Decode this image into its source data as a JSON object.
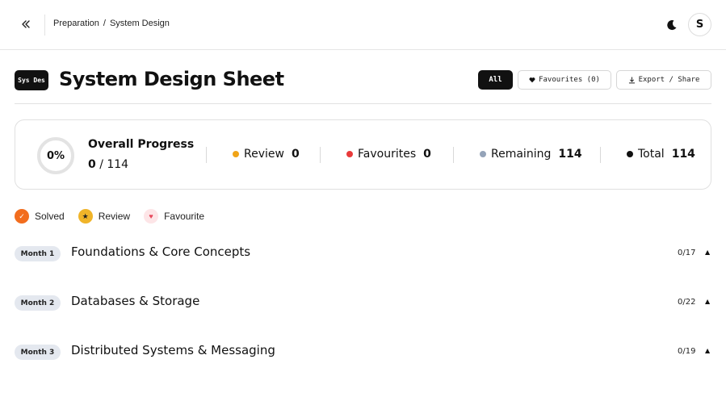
{
  "breadcrumb": {
    "parent": "Preparation",
    "separator": "/",
    "current": "System Design"
  },
  "user": {
    "initial": "S"
  },
  "sheet": {
    "badge": "Sys Des",
    "title": "System Design Sheet"
  },
  "filters": {
    "all": "All",
    "favourites": "Favourites (0)",
    "export": "Export / Share"
  },
  "progress": {
    "percent_label": "0%",
    "percent_value": 0,
    "label": "Overall Progress",
    "solved": "0",
    "total_suffix": "/ 114",
    "stats": [
      {
        "label": "Review",
        "value": "0",
        "color": "#f0a418"
      },
      {
        "label": "Favourites",
        "value": "0",
        "color": "#e83a3a"
      },
      {
        "label": "Remaining",
        "value": "114",
        "color": "#94a3b8"
      },
      {
        "label": "Total",
        "value": "114",
        "color": "#111111"
      }
    ]
  },
  "legend": [
    {
      "label": "Solved",
      "icon": "check-icon"
    },
    {
      "label": "Review",
      "icon": "star-icon"
    },
    {
      "label": "Favourite",
      "icon": "heart-icon"
    }
  ],
  "months": [
    {
      "badge": "Month 1",
      "title": "Foundations & Core Concepts",
      "count": "0/17"
    },
    {
      "badge": "Month 2",
      "title": "Databases & Storage",
      "count": "0/22"
    },
    {
      "badge": "Month 3",
      "title": "Distributed Systems & Messaging",
      "count": "0/19"
    }
  ],
  "colors": {
    "accent": "#111111",
    "solved": "#f26d1e",
    "review": "#f0b429",
    "favourite": "#e74a5d"
  }
}
